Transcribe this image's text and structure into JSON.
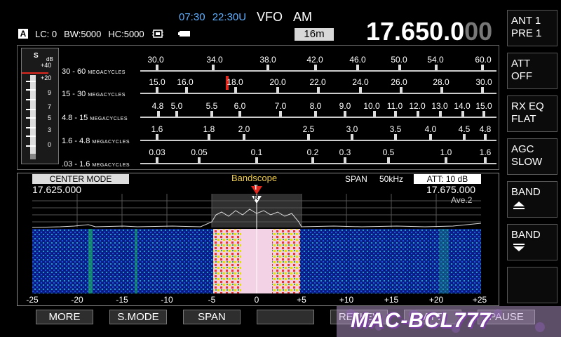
{
  "top": {
    "time_local": "07:30",
    "time_utc": "22:30U",
    "vfo": "VFO",
    "mode": "AM",
    "band": "16m",
    "freq_main": "17.650.0",
    "freq_dim": "00"
  },
  "status": {
    "vfo_letter": "A",
    "lc": "LC:  0",
    "bw": "BW:5000",
    "hc": "HC:5000"
  },
  "right_buttons": [
    {
      "l1": "ANT 1",
      "l2": "PRE 1"
    },
    {
      "l1": "ATT",
      "l2": "OFF"
    },
    {
      "l1": "RX EQ",
      "l2": "FLAT"
    },
    {
      "l1": "AGC",
      "l2": "SLOW"
    },
    {
      "l1": "BAND",
      "l2": ""
    },
    {
      "l1": "BAND",
      "l2": ""
    },
    {
      "l1": "",
      "l2": ""
    }
  ],
  "smeter": {
    "s_label": "S",
    "db_label": "dB",
    "marks": [
      "+40",
      "+20",
      "9",
      "7",
      "5",
      "3",
      "0"
    ]
  },
  "scales": [
    {
      "range": "30 - 60",
      "unit": "MEGACYCLES",
      "labels": [
        "30.0",
        "34.0",
        "38.0",
        "42.0",
        "46.0",
        "50.0",
        "54.0",
        "60.0"
      ]
    },
    {
      "range": "15 - 30",
      "unit": "MEGACYCLES",
      "labels": [
        "15.0",
        "16.0",
        "18.0",
        "20.0",
        "22.0",
        "24.0",
        "26.0",
        "28.0",
        "30.0"
      ]
    },
    {
      "range": "4.8 - 15",
      "unit": "MEGACYCLES",
      "labels": [
        "4.8",
        "5.0",
        "5.5",
        "6.0",
        "7.0",
        "8.0",
        "9.0",
        "10.0",
        "11.0",
        "12.0",
        "13.0",
        "14.0",
        "15.0"
      ]
    },
    {
      "range": "1.6 - 4.8",
      "unit": "MEGACYCLES",
      "labels": [
        "1.6",
        "1.8",
        "2.0",
        "2.5",
        "3.0",
        "3.5",
        "4.0",
        "4.5",
        "4.8"
      ]
    },
    {
      "range": ".03 - 1.6",
      "unit": "MEGACYCLES",
      "labels": [
        "0.03",
        "0.05",
        "0.1",
        "0.2",
        "0.3",
        "0.5",
        "1.0",
        "1.6"
      ]
    }
  ],
  "scope": {
    "center_mode": "CENTER MODE",
    "title": "Bandscope",
    "span_label": "SPAN",
    "span_value": "50kHz",
    "att": "ATT:  10  dB",
    "freq_left": "17.625.000",
    "freq_right": "17.675.000",
    "averaging": "Ave.2",
    "tx_marker": "T",
    "rx_marker": "R",
    "axis": [
      "-25",
      "-20",
      "-15",
      "-10",
      "-5",
      "0",
      "+5",
      "+10",
      "+15",
      "+20",
      "+25"
    ]
  },
  "bottom_buttons": [
    "MORE",
    "S.MODE",
    "SPAN",
    "",
    "REFLEV",
    "ATT",
    "PAUSE"
  ],
  "watermark": "MAC-BCL777",
  "colors": {
    "accent_blue": "#5fb0ff",
    "title_yellow": "#f2d04a",
    "marker_red": "#e0281e"
  }
}
